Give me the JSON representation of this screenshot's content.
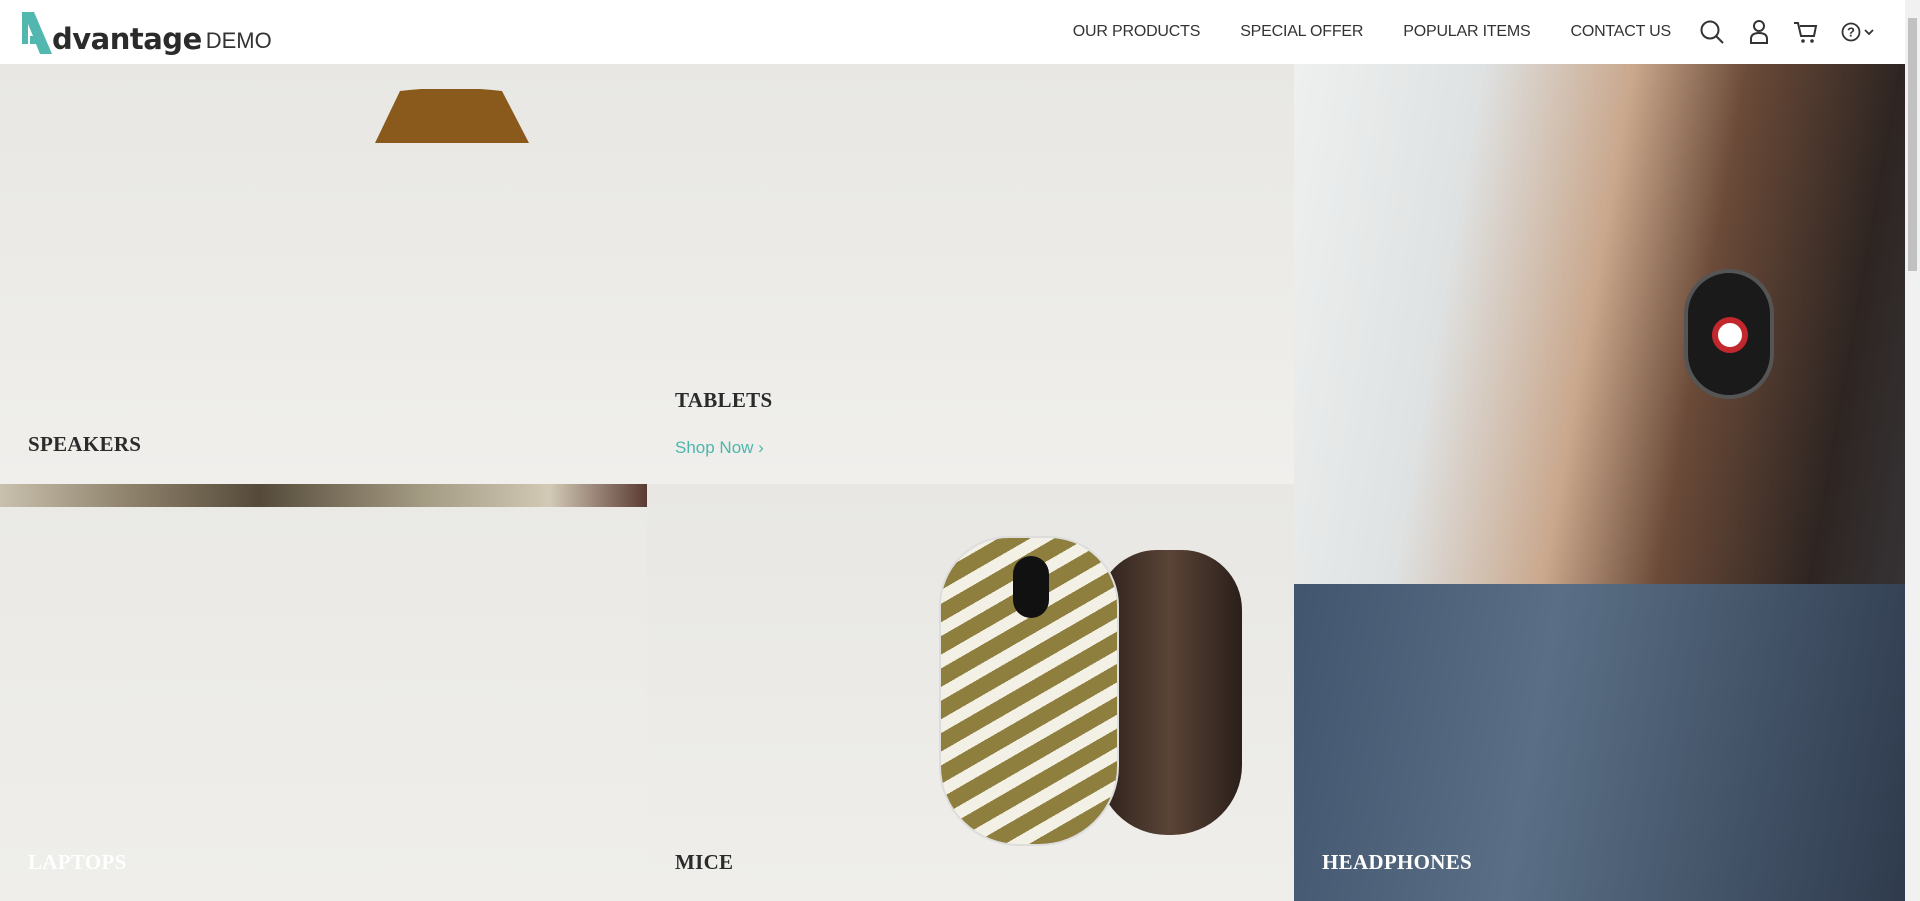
{
  "logo": {
    "main": "dvantage",
    "suffix": "DEMO",
    "color": "#52b7ae"
  },
  "nav": {
    "items": [
      "OUR PRODUCTS",
      "SPECIAL OFFER",
      "POPULAR ITEMS",
      "CONTACT US"
    ],
    "icons": [
      "search-icon",
      "user-icon",
      "cart-icon",
      "help-icon"
    ]
  },
  "categories": [
    {
      "title": "SPEAKERS"
    },
    {
      "title": "TABLETS",
      "link": "Shop Now"
    },
    {
      "title": "HEADPHONES"
    },
    {
      "title": "LAPTOPS"
    },
    {
      "title": "MICE"
    }
  ],
  "colors": {
    "accent": "#4db6ac",
    "tile_bg": "#edebe7"
  }
}
